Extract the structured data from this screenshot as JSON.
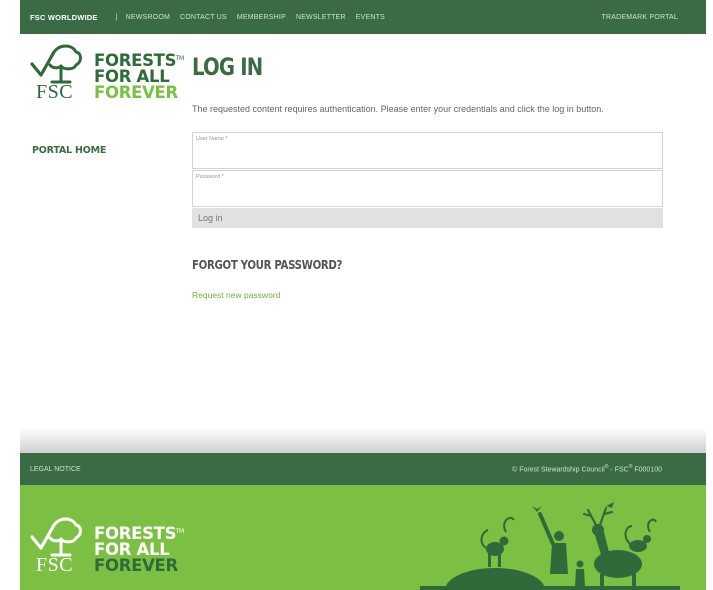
{
  "topnav": {
    "brand": "FSC WORLDWIDE",
    "separator": "|",
    "links": [
      "NEWSROOM",
      "CONTACT US",
      "MEMBERSHIP",
      "NEWSLETTER",
      "EVENTS"
    ],
    "trademark_portal": "TRADEMARK PORTAL"
  },
  "logo": {
    "line1": "FORESTS",
    "line2": "FOR ALL",
    "line3": "FOREVER",
    "fsc": "FSC",
    "tm": "TM"
  },
  "sidebar": {
    "portal_home": "PORTAL HOME"
  },
  "main": {
    "title": "LOG IN",
    "intro": "The requested content requires authentication. Please enter your credentials and click the log in button.",
    "username_label": "User Name *",
    "username_value": "",
    "password_label": "Password *",
    "password_value": "",
    "login_button": "Log in",
    "forgot_title": "FORGOT YOUR PASSWORD?",
    "request_link": "Request new password"
  },
  "footer": {
    "legal": "LEGAL NOTICE",
    "copyright_prefix": "© Forest Stewardship Council",
    "reg": "®",
    "copyright_mid": " - FSC",
    "copyright_suffix": " F000100"
  },
  "colors": {
    "dark_green": "#3a6b45",
    "light_green": "#7cc043",
    "link_green": "#6fb23a"
  }
}
